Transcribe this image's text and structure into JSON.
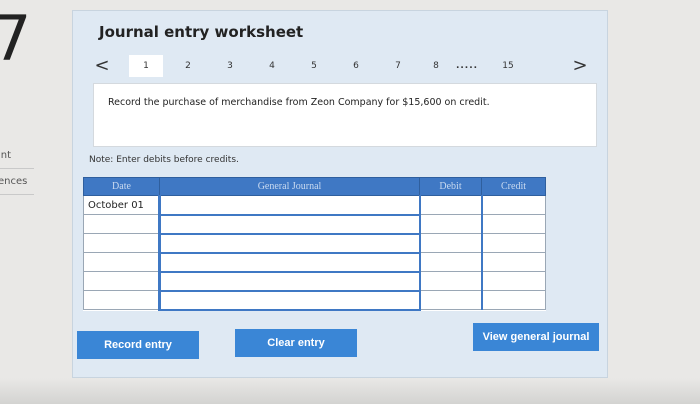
{
  "question": {
    "number": "7"
  },
  "sidebar": {
    "items": [
      {
        "label": "int"
      },
      {
        "label": "ences"
      }
    ]
  },
  "worksheet": {
    "title": "Journal entry worksheet",
    "nav": {
      "prev": "<",
      "next": ">"
    },
    "tabs": [
      "1",
      "2",
      "3",
      "4",
      "5",
      "6",
      "7",
      "8",
      ".....",
      "15"
    ],
    "instruction": "Record the purchase of merchandise from Zeon Company for $15,600 on credit.",
    "note": "Note: Enter debits before credits."
  },
  "table": {
    "headers": {
      "date": "Date",
      "journal": "General Journal",
      "debit": "Debit",
      "credit": "Credit"
    },
    "rows": [
      {
        "date": "October 01",
        "account": "",
        "debit": "",
        "credit": ""
      },
      {
        "date": "",
        "account": "",
        "debit": "",
        "credit": ""
      },
      {
        "date": "",
        "account": "",
        "debit": "",
        "credit": ""
      },
      {
        "date": "",
        "account": "",
        "debit": "",
        "credit": ""
      },
      {
        "date": "",
        "account": "",
        "debit": "",
        "credit": ""
      },
      {
        "date": "",
        "account": "",
        "debit": "",
        "credit": ""
      }
    ]
  },
  "buttons": {
    "record": "Record entry",
    "clear": "Clear entry",
    "view": "View general journal"
  },
  "colors": {
    "accent": "#3a86d6",
    "header": "#3f78c4",
    "panel": "#dfe9f3"
  }
}
